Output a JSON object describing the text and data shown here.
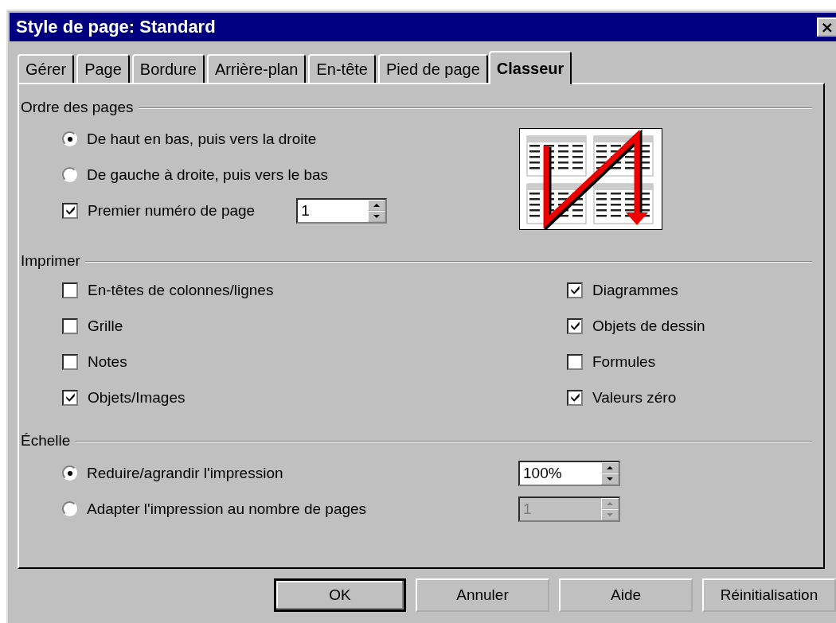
{
  "window": {
    "title": "Style de page: Standard",
    "close": "×"
  },
  "tabs": [
    {
      "label": "Gérer",
      "selected": false
    },
    {
      "label": "Page",
      "selected": false
    },
    {
      "label": "Bordure",
      "selected": false
    },
    {
      "label": "Arrière-plan",
      "selected": false
    },
    {
      "label": "En-tête",
      "selected": false
    },
    {
      "label": "Pied de page",
      "selected": false
    },
    {
      "label": "Classeur",
      "selected": true
    }
  ],
  "page_order": {
    "title": "Ordre des pages",
    "options": [
      {
        "label": "De haut en bas, puis vers la droite",
        "selected": true
      },
      {
        "label": "De gauche à droite, puis vers le bas",
        "selected": false
      }
    ],
    "first_page": {
      "label": "Premier numéro de page",
      "checked": true,
      "value": "1"
    }
  },
  "print": {
    "title": "Imprimer",
    "left": [
      {
        "label": "En-têtes de colonnes/lignes",
        "checked": false
      },
      {
        "label": "Grille",
        "checked": false
      },
      {
        "label": "Notes",
        "checked": false
      },
      {
        "label": "Objets/Images",
        "checked": true
      }
    ],
    "right": [
      {
        "label": "Diagrammes",
        "checked": true
      },
      {
        "label": "Objets de dessin",
        "checked": true
      },
      {
        "label": "Formules",
        "checked": false
      },
      {
        "label": "Valeurs zéro",
        "checked": true
      }
    ]
  },
  "scale": {
    "title": "Échelle",
    "options": [
      {
        "label": "Reduire/agrandir l'impression",
        "selected": true,
        "value": "100%",
        "disabled": false
      },
      {
        "label": "Adapter l'impression au nombre de pages",
        "selected": false,
        "value": "1",
        "disabled": true
      }
    ]
  },
  "buttons": [
    {
      "label": "OK",
      "default": true
    },
    {
      "label": "Annuler",
      "default": false
    },
    {
      "label": "Aide",
      "default": false
    },
    {
      "label": "Réinitialisation",
      "default": false
    }
  ]
}
